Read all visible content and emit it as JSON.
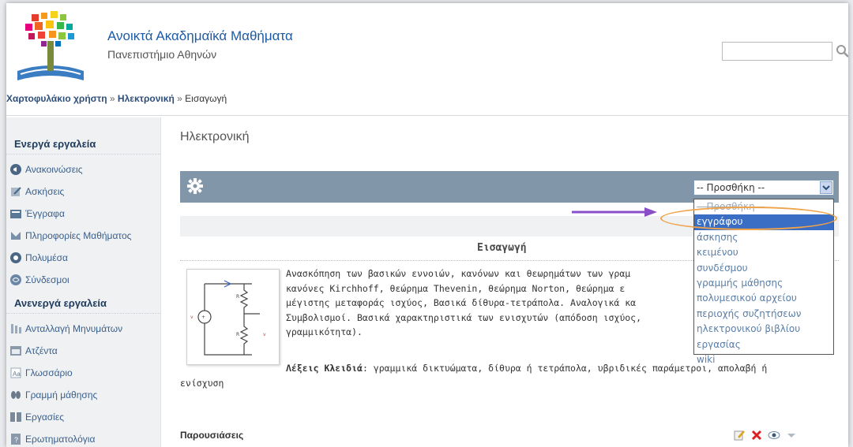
{
  "header": {
    "title": "Ανοικτά Ακαδημαϊκά Μαθήματα",
    "subtitle": "Πανεπιστήμιο Αθηνών",
    "search_placeholder": ""
  },
  "breadcrumb": {
    "items": [
      "Χαρτοφυλάκιο χρήστη",
      "Ηλεκτρονική",
      "Εισαγωγή"
    ],
    "separator": "»"
  },
  "sidebar": {
    "active_heading": "Ενεργά εργαλεία",
    "active_tools": [
      {
        "label": "Ανακοινώσεις",
        "icon": "announcement-icon"
      },
      {
        "label": "Ασκήσεις",
        "icon": "exercise-icon"
      },
      {
        "label": "Έγγραφα",
        "icon": "documents-icon"
      },
      {
        "label": "Πληροφορίες Μαθήματος",
        "icon": "info-icon"
      },
      {
        "label": "Πολυμέσα",
        "icon": "multimedia-icon"
      },
      {
        "label": "Σύνδεσμοι",
        "icon": "links-icon"
      }
    ],
    "inactive_heading": "Ανενεργά εργαλεία",
    "inactive_tools": [
      {
        "label": "Ανταλλαγή Μηνυμάτων",
        "icon": "messages-icon"
      },
      {
        "label": "Ατζέντα",
        "icon": "agenda-icon"
      },
      {
        "label": "Γλωσσάριο",
        "icon": "glossary-icon"
      },
      {
        "label": "Γραμμή μάθησης",
        "icon": "learning-path-icon"
      },
      {
        "label": "Εργασίες",
        "icon": "assignments-icon"
      },
      {
        "label": "Ερωτηματολόγια",
        "icon": "questionnaire-icon"
      }
    ]
  },
  "main": {
    "title": "Ηλεκτρονική",
    "add_select_value": "-- Προσθήκη --",
    "section_title": "Εισαγωγή",
    "description_lines": [
      "Ανασκόπηση των βασικών εννοιών, κανόνων και θεωρημάτων των γραμ",
      "κανόνες Kirchhoff, θεώρημα Thevenin, θεώρημα Norton, θεώρημα ε",
      "μέγιστης μεταφοράς ισχύος, Βασικά δίθυρα-τετράπολα. Αναλογικά κα",
      "Συμβολισμοί. Βασικά χαρακτηριστικά των ενισχυτών (απόδοση ισχύος,",
      "γραμμικότητα)."
    ],
    "keywords_label": "Λέξεις Κλειδιά",
    "keywords_line1": ": γραμμικά δικτυώματα, δίθυρα ή τετράπολα, υβριδικές παράμετροι, απολαβή ή",
    "keywords_line2": "ενίσχυση",
    "presentations_label": "Παρουσιάσεις"
  },
  "dropdown": {
    "options": [
      "-- Προσθήκη --",
      "εγγράφου",
      "άσκησης",
      "κειμένου",
      "συνδέσμου",
      "γραμμής μάθησης",
      "πολυμεσικού αρχείου",
      "περιοχής συζητήσεων",
      "ηλεκτρονικού βιβλίου",
      "εργασίας",
      "wiki"
    ],
    "selected": "εγγράφου"
  },
  "colors": {
    "accent": "#1e5ba5",
    "toolbar": "#8196a8",
    "selected_option": "#3a6ec4",
    "annotation_ring": "#f0a34a",
    "annotation_arrow": "#8a4fc8"
  }
}
